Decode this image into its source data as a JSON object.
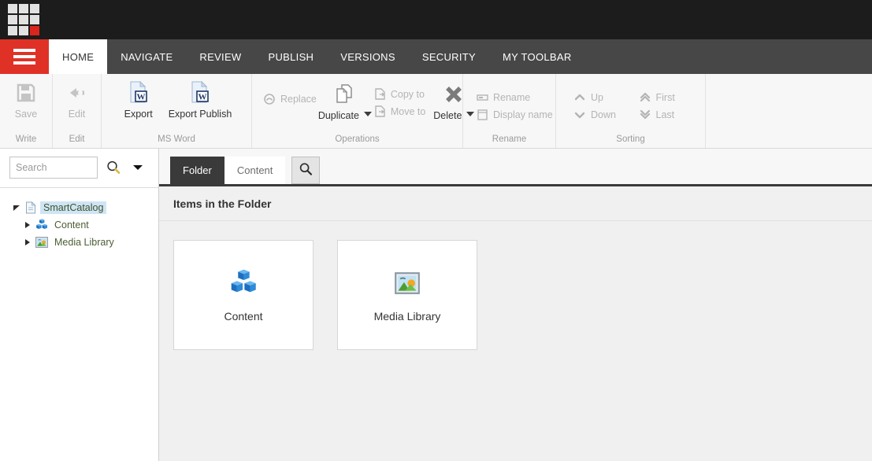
{
  "topbar": {
    "logo_name": "sitecore-logo"
  },
  "tabstrip": {
    "menu_label": "menu-button",
    "tabs": [
      {
        "label": "HOME",
        "active": true
      },
      {
        "label": "NAVIGATE",
        "active": false
      },
      {
        "label": "REVIEW",
        "active": false
      },
      {
        "label": "PUBLISH",
        "active": false
      },
      {
        "label": "VERSIONS",
        "active": false
      },
      {
        "label": "SECURITY",
        "active": false
      },
      {
        "label": "MY TOOLBAR",
        "active": false
      }
    ]
  },
  "ribbon": {
    "groups": [
      {
        "label": "Write",
        "commands": [
          {
            "label": "Save",
            "icon": "save-icon",
            "enabled": false
          }
        ]
      },
      {
        "label": "Edit",
        "commands": [
          {
            "label": "Edit",
            "icon": "edit-icon",
            "enabled": false
          }
        ]
      },
      {
        "label": "MS Word",
        "commands": [
          {
            "label": "Export",
            "icon": "word-export-icon",
            "enabled": true
          },
          {
            "label": "Export Publish",
            "icon": "word-export-publish-icon",
            "enabled": true
          }
        ]
      },
      {
        "label": "Operations",
        "replace": {
          "label": "Replace",
          "icon": "replace-icon",
          "enabled": false
        },
        "duplicate": {
          "label": "Duplicate",
          "icon": "duplicate-icon",
          "enabled": true,
          "has_dropdown": true
        },
        "copy_to": {
          "label": "Copy to",
          "icon": "copy-to-icon",
          "enabled": false
        },
        "move_to": {
          "label": "Move to",
          "icon": "move-to-icon",
          "enabled": false
        },
        "delete": {
          "label": "Delete",
          "icon": "delete-icon",
          "enabled": true,
          "has_dropdown": true
        }
      },
      {
        "label": "Rename",
        "commands": [
          {
            "label": "Rename",
            "icon": "rename-icon",
            "enabled": false
          },
          {
            "label": "Display name",
            "icon": "display-name-icon",
            "enabled": false
          }
        ]
      },
      {
        "label": "Sorting",
        "col1": [
          {
            "label": "Up",
            "icon": "chevron-up-icon",
            "enabled": false
          },
          {
            "label": "Down",
            "icon": "chevron-down-icon",
            "enabled": false
          }
        ],
        "col2": [
          {
            "label": "First",
            "icon": "double-chevron-up-icon",
            "enabled": false
          },
          {
            "label": "Last",
            "icon": "double-chevron-down-icon",
            "enabled": false
          }
        ]
      }
    ]
  },
  "sidebar": {
    "search": {
      "value": "",
      "placeholder": "Search",
      "search_icon": "magnifier-icon",
      "dropdown_icon": "chevron-down-icon"
    },
    "tree": [
      {
        "label": "SmartCatalog",
        "level": 0,
        "icon": "document-icon",
        "expanded": true,
        "selected": true
      },
      {
        "label": "Content",
        "level": 1,
        "icon": "cubes-icon",
        "expanded": false,
        "selected": false
      },
      {
        "label": "Media Library",
        "level": 1,
        "icon": "image-icon",
        "expanded": false,
        "selected": false
      }
    ]
  },
  "main": {
    "tabs": [
      {
        "label": "Folder",
        "active": true
      },
      {
        "label": "Content",
        "active": false
      }
    ],
    "search_tab_icon": "magnifier-icon",
    "section_title": "Items in the Folder",
    "items": [
      {
        "label": "Content",
        "icon": "cubes-icon"
      },
      {
        "label": "Media Library",
        "icon": "image-icon"
      }
    ]
  },
  "colors": {
    "accent_red": "#e03127",
    "tabstrip_bg": "#474747",
    "active_tab_bg": "#3a3a3a",
    "selection_blue": "#cfe5f5",
    "tree_text": "#4b5e33",
    "disabled_text": "#b4b4b4"
  }
}
